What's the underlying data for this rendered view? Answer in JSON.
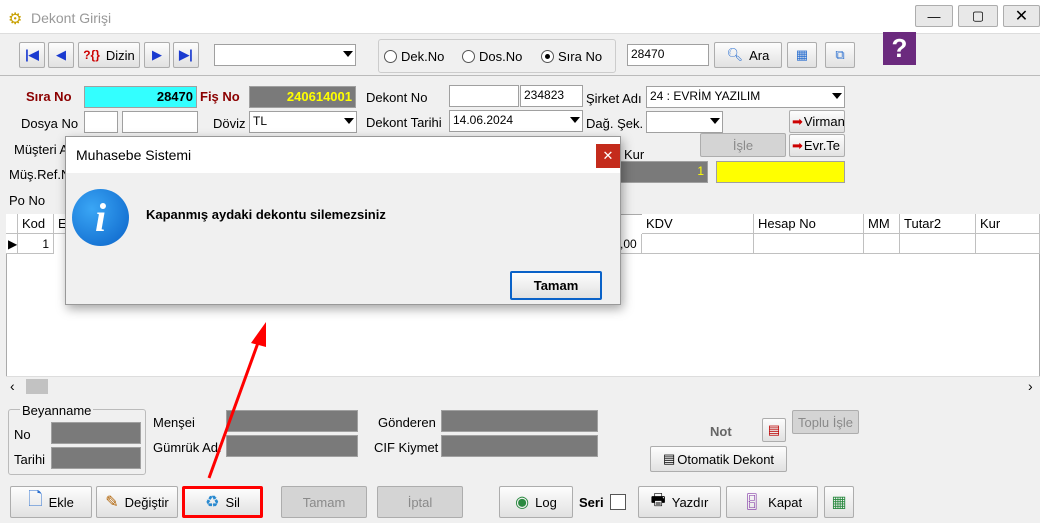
{
  "window": {
    "title": "Dekont Girişi"
  },
  "toolbar": {
    "dizin_label": "Dizin",
    "search_combo_value": "",
    "radio_dekno": "Dek.No",
    "radio_dosno": "Dos.No",
    "radio_sirano": "Sıra No",
    "search_value": "28470",
    "ara_label": "Ara"
  },
  "form": {
    "sira_no_label": "Sıra No",
    "sira_no_value": "28470",
    "fis_no_label": "Fiş No",
    "fis_no_value": "240614001",
    "dekont_no_label": "Dekont No",
    "dekont_no_value1": "",
    "dekont_no_value2": "234823",
    "sirket_adi_label": "Şirket Adı",
    "sirket_adi_value": "24 : EVRİM YAZILIM",
    "dosya_no_label": "Dosya No",
    "doviz_label": "Döviz",
    "doviz_value": "TL",
    "dekont_tarihi_label": "Dekont Tarihi",
    "dekont_tarihi_value": "14.06.2024",
    "dag_sek_label": "Dağ. Şek.",
    "virman_label": "Virman",
    "musteri_label": "Müşteri A",
    "isle_label": "İşle",
    "evr_label": "Evr.Te",
    "kur_label": "Kur",
    "kur_value": "1",
    "mus_ref_label": "Müş.Ref.N",
    "po_no_label": "Po No"
  },
  "grid": {
    "columns": [
      "Kod",
      "E",
      "KDV",
      "Hesap No",
      "MM",
      "Tutar2",
      "Kur"
    ],
    "row": {
      "kod": "1",
      "partial": ",00"
    }
  },
  "footer": {
    "beyanname_label": "Beyanname",
    "no_label": "No",
    "tarihi_label": "Tarihi",
    "mensei_label": "Menşei",
    "gumruk_label": "Gümrük Adı",
    "gonderen_label": "Gönderen",
    "cif_label": "CIF Kiymet",
    "not_label": "Not",
    "toplu_isle_label": "Toplu İşle",
    "otomatik_label": "Otomatik Dekont"
  },
  "actions": {
    "ekle": "Ekle",
    "degistir": "Değiştir",
    "sil": "Sil",
    "tamam": "Tamam",
    "iptal": "İptal",
    "log": "Log",
    "seri": "Seri",
    "yazdir": "Yazdır",
    "kapat": "Kapat"
  },
  "dialog": {
    "title": "Muhasebe Sistemi",
    "message": "Kapanmış aydaki dekontu silemezsiniz",
    "ok_label": "Tamam"
  },
  "colors": {
    "highlight_cyan": "#33ffff",
    "fis_yellow": "#ffff00",
    "annotation_red": "#ff0000"
  }
}
